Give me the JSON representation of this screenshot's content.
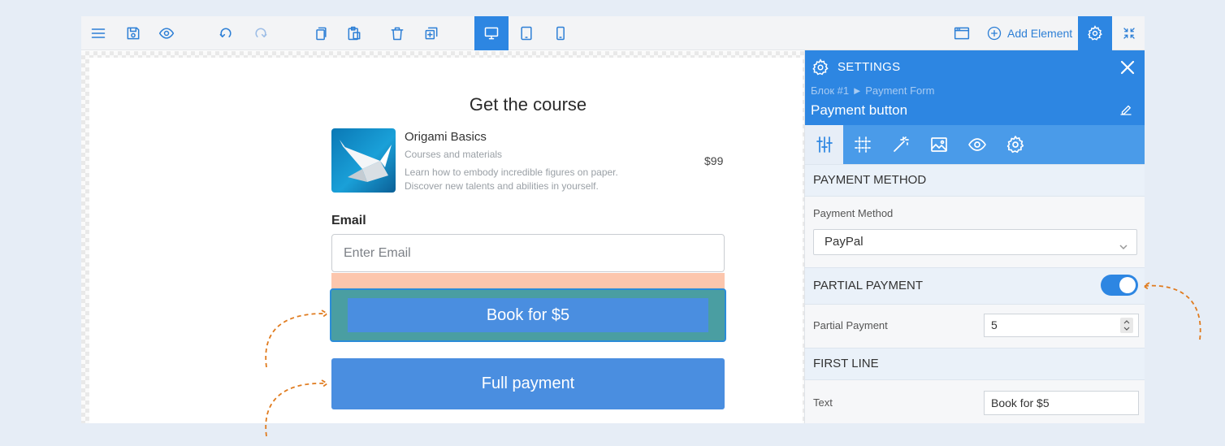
{
  "toolbar": {
    "icons": [
      "menu-icon",
      "save-icon",
      "preview-icon",
      "undo-icon",
      "redo-icon",
      "copy-icon",
      "paste-icon",
      "delete-icon",
      "duplicate-icon",
      "desktop-icon",
      "tablet-icon",
      "mobile-icon",
      "layout-icon",
      "plus-circle-icon",
      "gear-icon",
      "collapse-icon"
    ],
    "add_element_label": "Add Element",
    "active_device": "desktop"
  },
  "canvas": {
    "heading": "Get the course",
    "product": {
      "name": "Origami Basics",
      "subtitle": "Courses and materials",
      "description": "Learn how to embody incredible figures on paper. Discover new talents and abilities in yourself.",
      "price": "$99"
    },
    "email_label": "Email",
    "email_placeholder": "Enter Email",
    "book_button": "Book for $5",
    "full_button": "Full payment"
  },
  "settings": {
    "title": "SETTINGS",
    "breadcrumb": "Блок #1 ► Payment Form",
    "element_name": "Payment button",
    "tabs": [
      "sliders-icon",
      "grid-icon",
      "magic-wand-icon",
      "image-icon",
      "eye-icon",
      "gear-icon"
    ],
    "active_tab": 0,
    "sections": {
      "payment_method": "PAYMENT METHOD",
      "partial_payment": "PARTIAL PAYMENT",
      "first_line": "FIRST LINE"
    },
    "payment_method_label": "Payment Method",
    "payment_method_value": "PayPal",
    "partial_payment_enabled": true,
    "partial_payment_label": "Partial Payment",
    "partial_payment_value": "5",
    "text_label": "Text",
    "text_value": "Book for $5"
  },
  "colors": {
    "accent": "#2d86e2",
    "button": "#4a8ee0",
    "selection": "#4a9ea2",
    "peach": "#fcc6ad",
    "annotation": "#e07b1e"
  }
}
